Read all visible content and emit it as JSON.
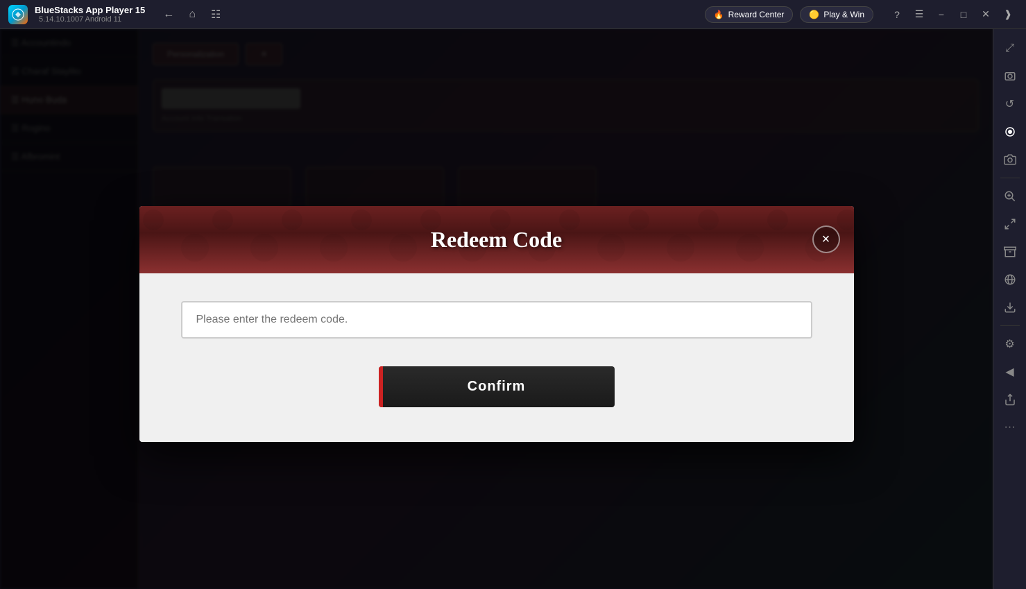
{
  "titlebar": {
    "app_name": "BlueStacks App Player 15",
    "version": "5.14.10.1007  Android 11",
    "reward_center": "Reward Center",
    "play_win": "Play & Win"
  },
  "modal": {
    "title": "Redeem Code",
    "input_placeholder": "Please enter the redeem code.",
    "confirm_label": "Confirm",
    "close_label": "×"
  },
  "right_sidebar": {
    "icons": [
      {
        "name": "expand-icon",
        "symbol": "⤢"
      },
      {
        "name": "screenshot-icon",
        "symbol": "📷"
      },
      {
        "name": "refresh-icon",
        "symbol": "↺"
      },
      {
        "name": "record-icon",
        "symbol": "⏺"
      },
      {
        "name": "camera-icon",
        "symbol": "📸"
      },
      {
        "name": "zoom-in-icon",
        "symbol": "⊕"
      },
      {
        "name": "zoom-out-icon",
        "symbol": "⊖"
      },
      {
        "name": "save-icon",
        "symbol": "💾"
      },
      {
        "name": "globe-icon",
        "symbol": "🌐"
      },
      {
        "name": "download-icon",
        "symbol": "⬇"
      },
      {
        "name": "settings-icon",
        "symbol": "⚙"
      },
      {
        "name": "arrow-left-icon",
        "symbol": "◀"
      },
      {
        "name": "share-icon",
        "symbol": "⤴"
      },
      {
        "name": "more-icon",
        "symbol": "···"
      }
    ]
  },
  "app_background": {
    "sidebar_items": [
      {
        "label": "Accountindo",
        "active": false
      },
      {
        "label": "Charaf Staylito",
        "active": false
      },
      {
        "label": "Huno Buda",
        "active": true
      },
      {
        "label": "Rogino",
        "active": false
      },
      {
        "label": "Afbromint",
        "active": false
      }
    ],
    "buttons": [
      {
        "label": "Personalization"
      },
      {
        "label": ""
      }
    ]
  }
}
